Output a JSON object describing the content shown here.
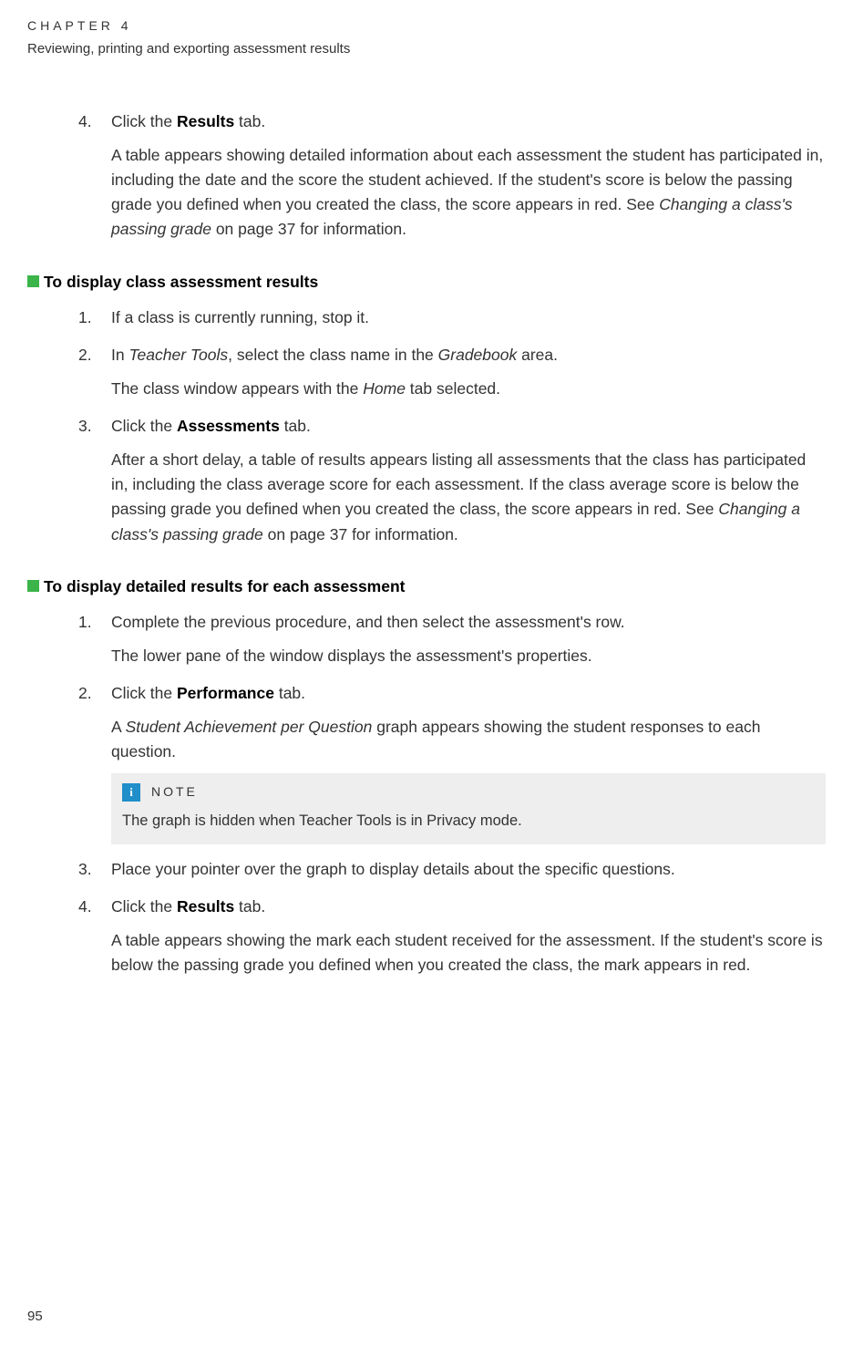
{
  "chapter": {
    "label": "CHAPTER 4",
    "title": "Reviewing, printing and exporting assessment results"
  },
  "topBlock": {
    "num": "4.",
    "line_pre": "Click the ",
    "line_bold": "Results",
    "line_post": " tab.",
    "para_a": "A table appears showing detailed information about each assessment the student has participated in, including the date and the score the student achieved. If the student's score is below the passing grade you defined when you created the class, the score appears in red. See ",
    "para_ref": "Changing a class's passing grade",
    "para_b": " on page 37 for information."
  },
  "proc1": {
    "heading": "To display class assessment results",
    "steps": {
      "s1": {
        "num": "1.",
        "text": "If a class is currently running, stop it."
      },
      "s2": {
        "num": "2.",
        "pre": "In ",
        "it1": "Teacher Tools",
        "mid": ", select the class name in the ",
        "it2": "Gradebook",
        "post": " area.",
        "result_pre": "The class window appears with the ",
        "result_it": "Home",
        "result_post": " tab selected."
      },
      "s3": {
        "num": "3.",
        "pre": "Click the ",
        "bold": "Assessments",
        "post": " tab.",
        "para_a": "After a short delay, a table of results appears listing all assessments that the class has participated in, including the class average score for each assessment. If the class average score is below the passing grade you defined when you created the class, the score appears in red. See ",
        "para_ref": "Changing a class's passing grade",
        "para_b": " on page 37 for information."
      }
    }
  },
  "proc2": {
    "heading": "To display detailed results for each assessment",
    "steps": {
      "s1": {
        "num": "1.",
        "text": "Complete the previous procedure, and then select the assessment's row.",
        "result": "The lower pane of the window displays the assessment's properties."
      },
      "s2": {
        "num": "2.",
        "pre": "Click the ",
        "bold": "Performance",
        "post": " tab.",
        "res_pre": "A ",
        "res_it": "Student Achievement per Question",
        "res_post": " graph appears showing the student responses to each question.",
        "note_label": "NOTE",
        "note_icon": "i",
        "note_body": "The graph is hidden when Teacher Tools is in Privacy mode."
      },
      "s3": {
        "num": "3.",
        "text": "Place your pointer over the graph to display details about the specific questions."
      },
      "s4": {
        "num": "4.",
        "pre": "Click the ",
        "bold": "Results",
        "post": " tab.",
        "para": "A table appears showing the mark each student received for the assessment. If the student's score is below the passing grade you defined when you created the class, the mark appears in red."
      }
    }
  },
  "pageNumber": "95"
}
